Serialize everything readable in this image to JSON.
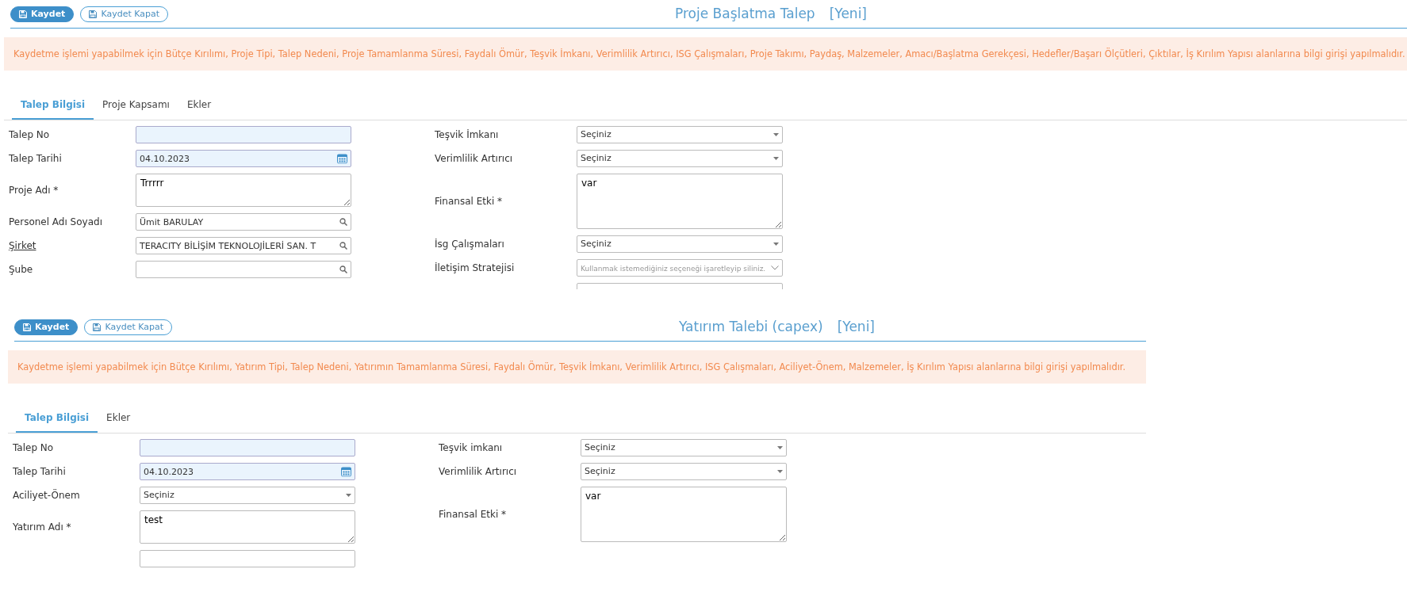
{
  "panels": [
    {
      "buttons": [
        {
          "label": "Kaydet",
          "kind": "primary"
        },
        {
          "label": "Kaydet Kapat",
          "kind": "outline"
        }
      ],
      "title": "Proje Başlatma Talep",
      "status": "[Yeni]",
      "alert": "Kaydetme işlemi yapabilmek için Bütçe Kırılımı, Proje Tipi, Talep Nedeni, Proje Tamamlanma Süresi, Faydalı Ömür, Teşvik İmkanı, Verimlilik Artırıcı, ISG Çalışmaları, Proje Takımı, Paydaş, Malzemeler, Amacı/Başlatma Gerekçesi, Hedefler/Başarı Ölçütleri, Çıktılar, İş Kırılım Yapısı alanlarına bilgi girişi yapılmalıdır.",
      "tabs": [
        {
          "label": "Talep Bilgisi",
          "selected": true
        },
        {
          "label": "Proje Kapsamı",
          "selected": false
        },
        {
          "label": "Ekler",
          "selected": false
        }
      ],
      "left": [
        {
          "label": "Talep No",
          "kind": "text",
          "readonly": true
        },
        {
          "label": "Talep Tarihi",
          "kind": "date",
          "value": "04.10.2023",
          "readonly": true
        },
        {
          "label": "Proje Adı *",
          "kind": "textarea",
          "value": "Trrrrr"
        },
        {
          "label": "Personel Adı Soyadı",
          "kind": "lookup",
          "value": "Ümit BARULAY"
        },
        {
          "label": "Şirket",
          "kind": "lookup",
          "value": "TERACITY BİLİŞİM TEKNOLOJİLERİ SAN. T",
          "link": true
        },
        {
          "label": "Şube",
          "kind": "lookup"
        }
      ],
      "right": [
        {
          "label": "Teşvik İmkanı",
          "kind": "select",
          "value": "Seçiniz"
        },
        {
          "label": "Verimlilik Artırıcı",
          "kind": "select",
          "value": "Seçiniz"
        },
        {
          "label": "Finansal Etki *",
          "kind": "textarea",
          "value": "var",
          "tall": true
        },
        {
          "label": "İsg Çalışmaları",
          "kind": "select",
          "value": "Seçiniz"
        },
        {
          "label": "İletişim Stratejisi",
          "kind": "multiselect",
          "placeholder": "Kullanmak istemediğiniz seçeneği işaretleyip siliniz."
        },
        {
          "kind": "text"
        }
      ]
    },
    {
      "buttons": [
        {
          "label": "Kaydet",
          "kind": "primary"
        },
        {
          "label": "Kaydet Kapat",
          "kind": "outline"
        }
      ],
      "title": "Yatırım Talebi (capex)",
      "status": "[Yeni]",
      "alert": "Kaydetme işlemi yapabilmek için Bütçe Kırılımı, Yatırım Tipi, Talep Nedeni, Yatırımın Tamamlanma Süresi, Faydalı Ömür, Teşvik İmkanı, Verimlilik Artırıcı, ISG Çalışmaları, Aciliyet-Önem, Malzemeler, İş Kırılım Yapısı alanlarına bilgi girişi yapılmalıdır.",
      "tabs": [
        {
          "label": "Talep Bilgisi",
          "selected": true
        },
        {
          "label": "Ekler",
          "selected": false
        }
      ],
      "left": [
        {
          "label": "Talep No",
          "kind": "text",
          "readonly": true
        },
        {
          "label": "Talep Tarihi",
          "kind": "date",
          "value": "04.10.2023",
          "readonly": true
        },
        {
          "label": "Aciliyet-Önem",
          "kind": "select",
          "value": "Seçiniz"
        },
        {
          "label": "Yatırım Adı *",
          "kind": "textarea",
          "value": "test"
        },
        {
          "kind": "text"
        }
      ],
      "right": [
        {
          "label": "Teşvik imkanı",
          "kind": "select",
          "value": "Seçiniz"
        },
        {
          "label": "Verimlilik Artırıcı",
          "kind": "select",
          "value": "Seçiniz"
        },
        {
          "label": "Finansal Etki *",
          "kind": "textarea",
          "value": "var",
          "tall": true
        }
      ]
    }
  ]
}
